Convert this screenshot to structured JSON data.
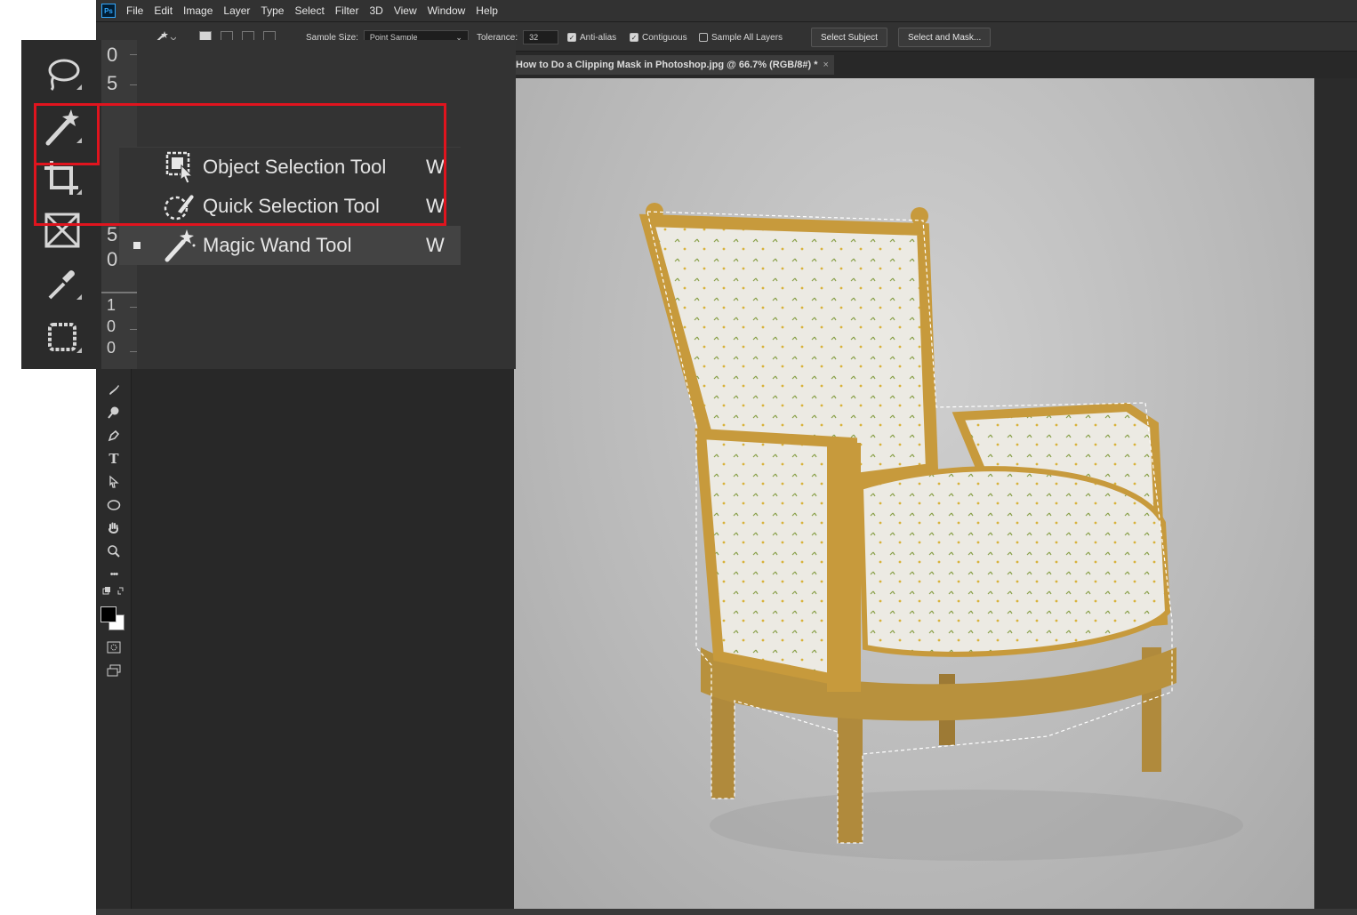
{
  "app": {
    "logo": "Ps",
    "accent": "#31a8ff",
    "highlight_color": "#e0141e"
  },
  "menu": [
    "File",
    "Edit",
    "Image",
    "Layer",
    "Type",
    "Select",
    "Filter",
    "3D",
    "View",
    "Window",
    "Help"
  ],
  "options": {
    "sample_size_label": "Sample Size:",
    "sample_size_value": "Point Sample",
    "tolerance_label": "Tolerance:",
    "tolerance_value": "32",
    "anti_alias_label": "Anti-alias",
    "anti_alias_checked": true,
    "contiguous_label": "Contiguous",
    "contiguous_checked": true,
    "sample_all_layers_label": "Sample All Layers",
    "sample_all_layers_checked": false,
    "select_subject_label": "Select Subject",
    "select_and_mask_label": "Select and Mask..."
  },
  "document": {
    "tab_title": "How to Do a Clipping Mask in Photoshop.jpg @ 66.7% (RGB/8#) *",
    "close": "×"
  },
  "toolbar": {
    "icons": [
      "lasso-icon",
      "magic-wand-icon",
      "crop-icon",
      "frame-icon",
      "eyedropper-icon",
      "patch-icon",
      "brush-icon",
      "dodge-icon",
      "pen-icon",
      "type-icon",
      "path-selection-icon",
      "ellipse-icon",
      "hand-icon",
      "zoom-icon",
      "more-icon"
    ],
    "type_glyph": "T",
    "more_glyph": "•••"
  },
  "ruler_digits": [
    "0",
    "5",
    "5",
    "0",
    "1",
    "0",
    "0"
  ],
  "flyout": {
    "items": [
      {
        "label": "Object Selection Tool",
        "shortcut": "W",
        "icon": "object-selection-icon",
        "selected": false
      },
      {
        "label": "Quick Selection Tool",
        "shortcut": "W",
        "icon": "quick-selection-icon",
        "selected": false
      },
      {
        "label": "Magic Wand Tool",
        "shortcut": "W",
        "icon": "magic-wand-icon",
        "selected": true
      }
    ]
  }
}
